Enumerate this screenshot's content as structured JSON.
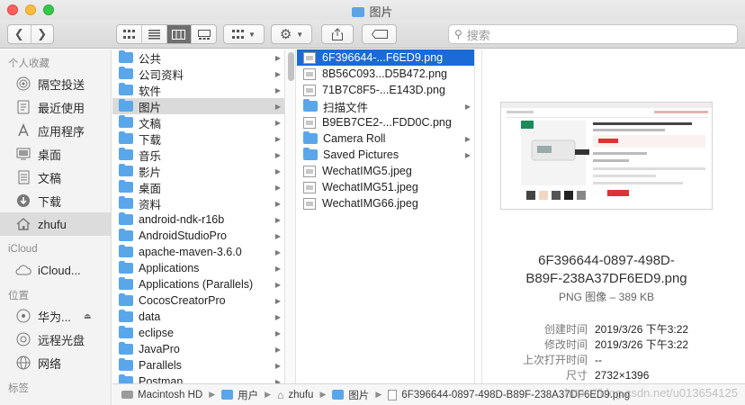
{
  "window": {
    "title": "图片"
  },
  "toolbar": {
    "back_icon": "chevron-left-icon",
    "forward_icon": "chevron-right-icon",
    "view_buttons": [
      "icon-view",
      "list-view",
      "column-view",
      "gallery-view"
    ],
    "group_icon": "group-grid-icon",
    "action_icon": "gear-icon",
    "share_icon": "share-icon",
    "tag_icon": "tag-icon",
    "search_placeholder": "搜索"
  },
  "sidebar": {
    "favorites_header": "个人收藏",
    "favorites": [
      {
        "label": "隔空投送",
        "icon": "airdrop-icon"
      },
      {
        "label": "最近使用",
        "icon": "recents-icon"
      },
      {
        "label": "应用程序",
        "icon": "applications-icon"
      },
      {
        "label": "桌面",
        "icon": "desktop-icon"
      },
      {
        "label": "文稿",
        "icon": "documents-icon"
      },
      {
        "label": "下载",
        "icon": "downloads-icon"
      },
      {
        "label": "zhufu",
        "icon": "home-icon",
        "selected": true
      }
    ],
    "icloud_header": "iCloud",
    "icloud": [
      {
        "label": "iCloud...",
        "icon": "cloud-icon"
      }
    ],
    "locations_header": "位置",
    "locations": [
      {
        "label": "华为...",
        "icon": "disk-icon",
        "eject": true
      },
      {
        "label": "远程光盘",
        "icon": "optical-disc-icon"
      },
      {
        "label": "网络",
        "icon": "network-icon"
      }
    ],
    "tags_header": "标签"
  },
  "column1": {
    "items": [
      {
        "label": "公共",
        "kind": "folder"
      },
      {
        "label": "公司资料",
        "kind": "folder"
      },
      {
        "label": "软件",
        "kind": "folder"
      },
      {
        "label": "图片",
        "kind": "folder",
        "selected": true
      },
      {
        "label": "文稿",
        "kind": "folder"
      },
      {
        "label": "下载",
        "kind": "folder"
      },
      {
        "label": "音乐",
        "kind": "folder"
      },
      {
        "label": "影片",
        "kind": "folder"
      },
      {
        "label": "桌面",
        "kind": "folder"
      },
      {
        "label": "资料",
        "kind": "folder"
      },
      {
        "label": "android-ndk-r16b",
        "kind": "folder"
      },
      {
        "label": "AndroidStudioPro",
        "kind": "folder"
      },
      {
        "label": "apache-maven-3.6.0",
        "kind": "folder"
      },
      {
        "label": "Applications",
        "kind": "folder"
      },
      {
        "label": "Applications (Parallels)",
        "kind": "folder"
      },
      {
        "label": "CocosCreatorPro",
        "kind": "folder"
      },
      {
        "label": "data",
        "kind": "folder"
      },
      {
        "label": "eclipse",
        "kind": "folder"
      },
      {
        "label": "JavaPro",
        "kind": "folder"
      },
      {
        "label": "Parallels",
        "kind": "folder"
      },
      {
        "label": "Postman",
        "kind": "folder"
      }
    ]
  },
  "column2": {
    "items": [
      {
        "label": "6F396644-...F6ED9.png",
        "kind": "file",
        "highlighted": true
      },
      {
        "label": "8B56C093...D5B472.png",
        "kind": "file"
      },
      {
        "label": "71B7C8F5-...E143D.png",
        "kind": "file"
      },
      {
        "label": "扫描文件",
        "kind": "folder"
      },
      {
        "label": "B9EB7CE2-...FDD0C.png",
        "kind": "file"
      },
      {
        "label": "Camera Roll",
        "kind": "folder"
      },
      {
        "label": "Saved Pictures",
        "kind": "folder"
      },
      {
        "label": "WechatIMG5.jpeg",
        "kind": "file"
      },
      {
        "label": "WechatIMG51.jpeg",
        "kind": "file"
      },
      {
        "label": "WechatIMG66.jpeg",
        "kind": "file"
      }
    ]
  },
  "preview": {
    "title_line1": "6F396644-0897-498D-",
    "title_line2": "B89F-238A37DF6ED9.png",
    "type_size": "PNG 图像 – 389 KB",
    "meta": [
      {
        "key": "创建时间",
        "value": "2019/3/26 下午3:22"
      },
      {
        "key": "修改时间",
        "value": "2019/3/26 下午3:22"
      },
      {
        "key": "上次打开时间",
        "value": "--"
      },
      {
        "key": "尺寸",
        "value": "2732×1396"
      }
    ]
  },
  "pathbar": {
    "segments": [
      {
        "label": "Macintosh HD",
        "icon": "hard-disk-icon"
      },
      {
        "label": "用户",
        "icon": "folder-icon"
      },
      {
        "label": "zhufu",
        "icon": "home-icon"
      },
      {
        "label": "图片",
        "icon": "folder-icon"
      },
      {
        "label": "6F396644-0897-498D-B89F-238A37DF6ED9.png",
        "icon": "file-icon"
      }
    ]
  },
  "watermark": "https://blog.csdn.net/u013654125"
}
